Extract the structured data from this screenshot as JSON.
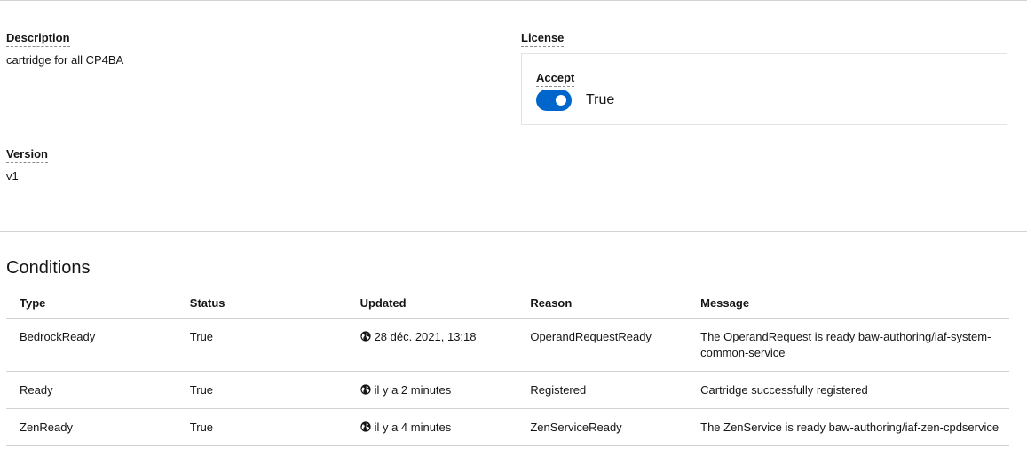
{
  "details": {
    "description_label": "Description",
    "description_value": "cartridge for all CP4BA",
    "version_label": "Version",
    "version_value": "v1",
    "license_label": "License",
    "accept_label": "Accept",
    "accept_value": "True",
    "accept_checked": true
  },
  "conditions": {
    "title": "Conditions",
    "columns": [
      "Type",
      "Status",
      "Updated",
      "Reason",
      "Message"
    ],
    "rows": [
      {
        "type": "BedrockReady",
        "status": "True",
        "updated": "28 déc. 2021, 13:18",
        "reason": "OperandRequestReady",
        "message": "The OperandRequest is ready baw-authoring/iaf-system-common-service"
      },
      {
        "type": "Ready",
        "status": "True",
        "updated": "il y a 2 minutes",
        "reason": "Registered",
        "message": "Cartridge successfully registered"
      },
      {
        "type": "ZenReady",
        "status": "True",
        "updated": "il y a 4 minutes",
        "reason": "ZenServiceReady",
        "message": "The ZenService is ready baw-authoring/iaf-zen-cpdservice"
      }
    ]
  },
  "colors": {
    "accent": "#0066cc",
    "border": "#d2d2d2"
  }
}
